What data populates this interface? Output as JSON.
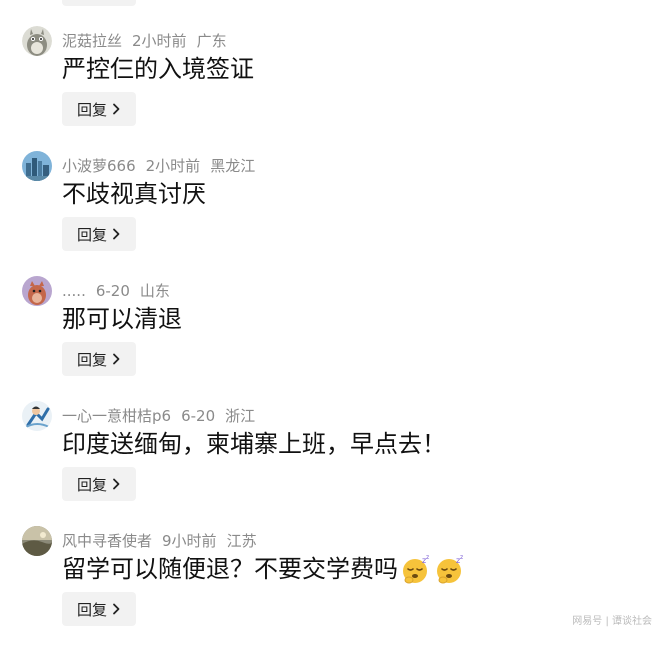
{
  "comments": [
    {
      "user": "泥菇拉丝",
      "time": "2小时前",
      "region": "广东",
      "text": "严控仨的入境签证",
      "avatar_icon": "totoro-avatar-icon",
      "has_emoji": false
    },
    {
      "user": "小波萝666",
      "time": "2小时前",
      "region": "黑龙江",
      "text": "不歧视真讨厌",
      "avatar_icon": "city-skyline-avatar-icon",
      "has_emoji": false
    },
    {
      "user": ".....",
      "time": "6-20",
      "region": "山东",
      "text": "那可以清退",
      "avatar_icon": "animal-avatar-icon",
      "has_emoji": false
    },
    {
      "user": "一心一意柑桔p6",
      "time": "6-20",
      "region": "浙江",
      "text": "印度送缅甸，柬埔寨上班，早点去！",
      "avatar_icon": "cartoon-avatar-icon",
      "has_emoji": false
    },
    {
      "user": "风中寻香使者",
      "time": "9小时前",
      "region": "江苏",
      "text": "留学可以随便退？不要交学费吗",
      "avatar_icon": "landscape-avatar-icon",
      "has_emoji": true,
      "emoji_icon": "sleeping-face-emoji-icon"
    }
  ],
  "reply_label": "回复",
  "reply_icon": "chevron-right-icon",
  "watermark": "网易号 | 谭谈社会",
  "colors": {
    "meta": "#8a8a8a",
    "text": "#111111",
    "button_bg": "#f2f2f2"
  }
}
